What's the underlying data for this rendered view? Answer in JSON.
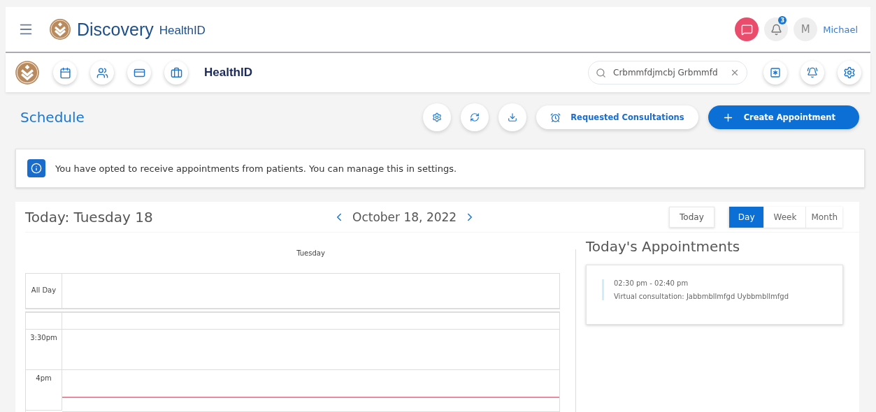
{
  "header": {
    "brand": "Discovery",
    "product": "HealthID",
    "notifications_badge": "3",
    "avatar_initial": "M",
    "user_name": "Michael"
  },
  "subbar": {
    "title": "HealthID",
    "search": {
      "value": "Crbmmfdjmcbj Grbmmfd"
    }
  },
  "schedule": {
    "title": "Schedule",
    "requested_label": "Requested Consultations",
    "create_label": "Create Appointment"
  },
  "info_banner": {
    "text": "You have opted to receive appointments from patients. You can manage this in settings."
  },
  "calendar": {
    "today_heading": "Today: Tuesday 18",
    "date": "October 18, 2022",
    "today_button": "Today",
    "views": [
      {
        "label": "Day",
        "selected": true
      },
      {
        "label": "Week",
        "selected": false
      },
      {
        "label": "Month",
        "selected": false
      }
    ],
    "day_header": "Tuesday",
    "all_day_label": "All Day",
    "time_slots": [
      {
        "kind": "partial"
      },
      {
        "kind": "labeled",
        "label": "3:30pm"
      },
      {
        "kind": "labeled",
        "label": "4pm",
        "now_line": true
      }
    ]
  },
  "appointments": {
    "title": "Today's Appointments",
    "items": [
      {
        "time": "02:30 pm - 02:40 pm",
        "description": "Virtual consultation: Jabbmbllmfgd Uybbmbllmfgd"
      }
    ]
  }
}
